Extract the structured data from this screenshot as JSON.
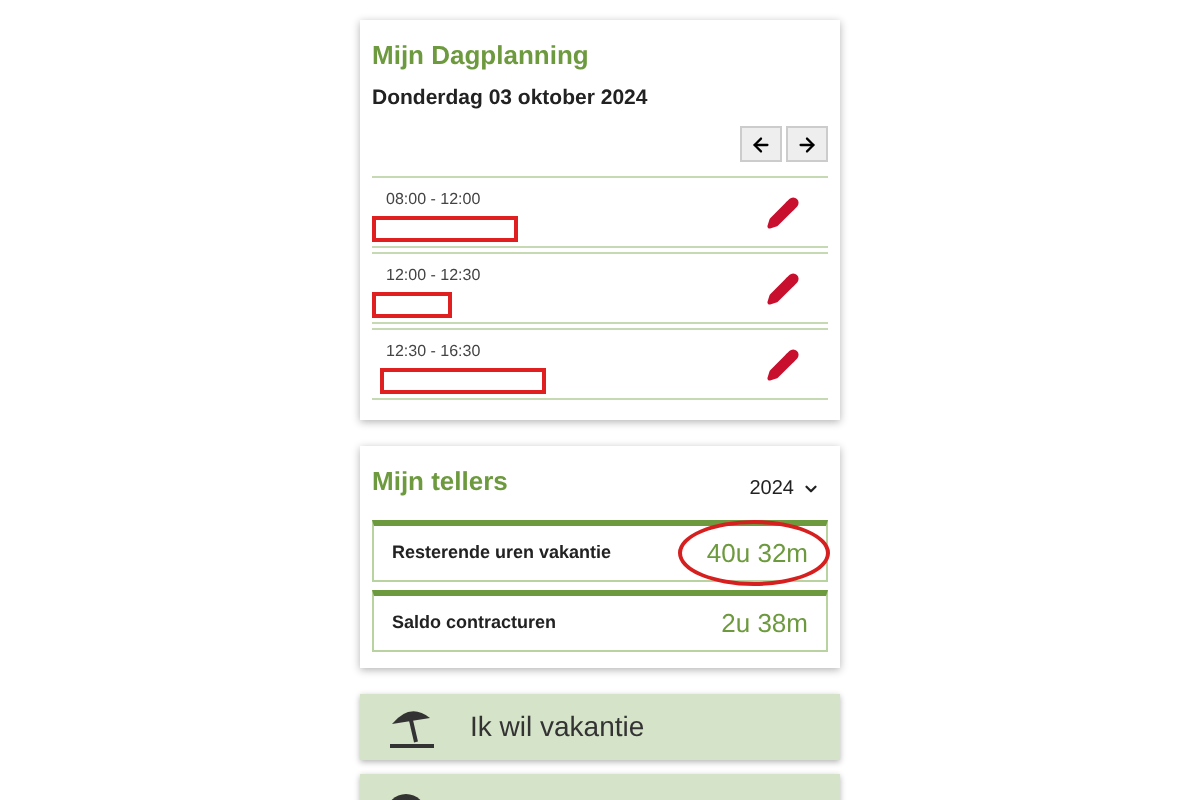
{
  "planning": {
    "title": "Mijn Dagplanning",
    "date": "Donderdag 03 oktober 2024",
    "entries": [
      {
        "time": "08:00 - 12:00"
      },
      {
        "time": "12:00 - 12:30"
      },
      {
        "time": "12:30 - 16:30"
      }
    ]
  },
  "counters": {
    "title": "Mijn tellers",
    "year": "2024",
    "items": [
      {
        "label": "Resterende uren vakantie",
        "value": "40u 32m",
        "highlighted": true
      },
      {
        "label": "Saldo contracturen",
        "value": "2u 38m",
        "highlighted": false
      }
    ]
  },
  "actions": [
    {
      "kind": "vacation",
      "label": "Ik wil vakantie"
    },
    {
      "kind": "sick"
    }
  ]
}
